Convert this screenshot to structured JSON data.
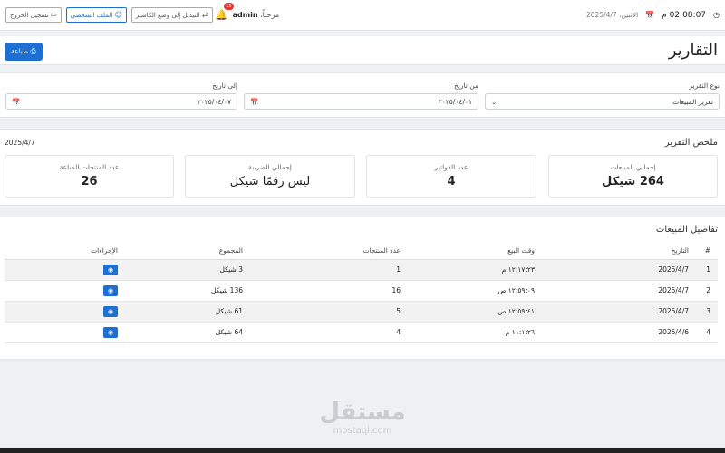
{
  "topbar": {
    "time": "02:08:07 م",
    "date_label": "الاثنين، 2025/4/7",
    "welcome_prefix": "مرحباً،",
    "username": "admin",
    "notif_count": "15",
    "switch_cashier": "التبديل إلى وضع الكاشير",
    "profile": "الملف الشخصي",
    "logout": "تسجيل الخروج"
  },
  "header": {
    "title": "التقارير",
    "print": "طباعة"
  },
  "filters": {
    "report_type_label": "نوع التقرير",
    "report_type_value": "تقرير المبيعات",
    "from_label": "من تاريخ",
    "from_value": "٢٠٢٥/٠٤/٠١",
    "to_label": "إلى تاريخ",
    "to_value": "٢٠٢٥/٠٤/٠٧"
  },
  "summary": {
    "title": "ملخص التقرير",
    "date": "2025/4/7",
    "cards": [
      {
        "label": "إجمالي المبيعات",
        "value": "264 شيكل"
      },
      {
        "label": "عدد الفواتير",
        "value": "4"
      },
      {
        "label": "إجمالي الضريبة",
        "value": "ليس رقمًا شيكل"
      },
      {
        "label": "عدد المنتجات المباعة",
        "value": "26"
      }
    ]
  },
  "details": {
    "title": "تفاصيل المبيعات",
    "headers": [
      "#",
      "التاريخ",
      "وقت البيع",
      "عدد المنتجات",
      "المجموع",
      "الإجراءات"
    ],
    "rows": [
      [
        "1",
        "2025/4/7",
        "١٢:١٧:٢٣ م",
        "1",
        "3 شيكل"
      ],
      [
        "2",
        "2025/4/7",
        "١٢:٥٩:٠٩ ص",
        "16",
        "136 شيكل"
      ],
      [
        "3",
        "2025/4/7",
        "١٢:٥٩:٤١ ص",
        "5",
        "61 شيكل"
      ],
      [
        "4",
        "2025/4/6",
        "١١:١:٢٦ م",
        "4",
        "64 شيكل"
      ]
    ]
  },
  "watermark": {
    "arabic": "مستقل",
    "latin": "mostaql.com"
  },
  "colors": {
    "primary": "#1d6fd1",
    "alert": "#e33333"
  }
}
